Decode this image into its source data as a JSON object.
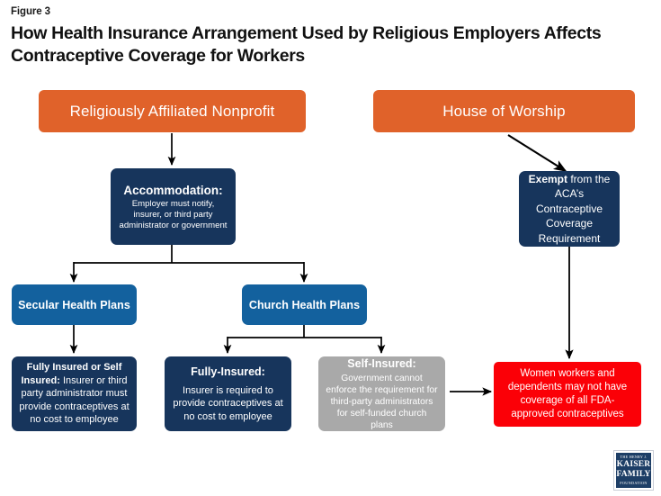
{
  "header": {
    "figure_label": "Figure 3",
    "title": "How Health Insurance Arrangement Used by Religious Employers Affects Contraceptive Coverage for Workers"
  },
  "palette": {
    "orange": "#e0622a",
    "navy": "#17355c",
    "blue": "#13619e",
    "grey": "#a9a9a9",
    "red": "#fb0007",
    "connector": "#000000",
    "page_background": "#ffffff",
    "node_text": "#ffffff",
    "logo_navy": "#1d3e66"
  },
  "diagram": {
    "type": "flowchart",
    "nodes": [
      {
        "id": "religiously-affiliated-nonprofit",
        "label": "Religiously Affiliated Nonprofit",
        "color": "orange",
        "shape": "rounded-rect"
      },
      {
        "id": "house-of-worship",
        "label": "House of Worship",
        "color": "orange",
        "shape": "rounded-rect"
      },
      {
        "id": "accommodation",
        "title": "Accommodation",
        "title_suffix": ":",
        "body": "Employer must notify, insurer, or third party administrator or government",
        "color": "navy",
        "shape": "rounded-rect"
      },
      {
        "id": "exempt",
        "title": "Exempt",
        "body": " from the ACA’s Contraceptive Coverage Requirement",
        "color": "navy",
        "shape": "rounded-rect"
      },
      {
        "id": "secular-health-plans",
        "label": "Secular Health Plans",
        "color": "blue",
        "shape": "rounded-rect"
      },
      {
        "id": "church-health-plans",
        "label": "Church Health Plans",
        "color": "blue",
        "shape": "rounded-rect"
      },
      {
        "id": "fully-insured-or-self-insured",
        "title": "Fully Insured or Self Insured",
        "title_suffix": ":",
        "body": " Insurer or third party administrator must provide contraceptives at no cost to employee",
        "color": "navy",
        "shape": "rounded-rect"
      },
      {
        "id": "fully-insured",
        "title": "Fully-Insured:",
        "body": "Insurer is required to provide contraceptives at no cost to employee",
        "color": "navy",
        "shape": "rounded-rect"
      },
      {
        "id": "self-insured",
        "title": "Self-Insured:",
        "body": "Government cannot enforce the requirement for third-party administrators for self-funded church plans",
        "color": "grey",
        "shape": "rounded-rect"
      },
      {
        "id": "outcome-no-coverage",
        "label": "Women workers and dependents may not have coverage of all FDA-approved contraceptives",
        "color": "red",
        "shape": "rounded-rect"
      }
    ],
    "edges": [
      {
        "from": "religiously-affiliated-nonprofit",
        "to": "accommodation",
        "style": "straight-down-arrow"
      },
      {
        "from": "house-of-worship",
        "to": "exempt",
        "style": "diagonal-arrow"
      },
      {
        "from": "accommodation",
        "to": "secular-health-plans",
        "style": "split-down-arrow"
      },
      {
        "from": "accommodation",
        "to": "church-health-plans",
        "style": "split-down-arrow"
      },
      {
        "from": "secular-health-plans",
        "to": "fully-insured-or-self-insured",
        "style": "straight-down-arrow"
      },
      {
        "from": "church-health-plans",
        "to": "fully-insured",
        "style": "split-down-arrow"
      },
      {
        "from": "church-health-plans",
        "to": "self-insured",
        "style": "split-down-arrow"
      },
      {
        "from": "self-insured",
        "to": "outcome-no-coverage",
        "style": "straight-right-arrow"
      },
      {
        "from": "exempt",
        "to": "outcome-no-coverage",
        "style": "straight-down-arrow"
      }
    ]
  },
  "logo": {
    "line1": "THE HENRY J.",
    "line2": "KAISER",
    "line3": "FAMILY",
    "line4": "FOUNDATION"
  }
}
